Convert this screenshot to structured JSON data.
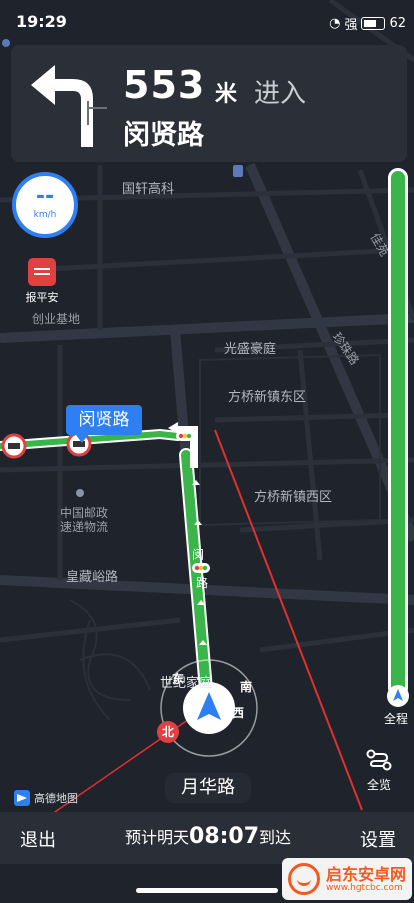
{
  "status_bar": {
    "time": "19:29",
    "signal_text": "强",
    "battery": "62"
  },
  "guidance": {
    "distance": "553",
    "unit": "米",
    "action": "进入",
    "road": "闵贤路"
  },
  "speed": {
    "value": "--",
    "unit": "km/h"
  },
  "safety": {
    "label": "报平安"
  },
  "route_progress": {
    "label": "全程"
  },
  "overview": {
    "label": "全览"
  },
  "map": {
    "labels": {
      "guoxuan": "国轩高科",
      "chuangye": "创业基地",
      "guangsheng": "光盛豪庭",
      "fangqiao_east": "方桥新镇东区",
      "fangqiao_west": "方桥新镇西区",
      "post": "中国邮政",
      "express": "速递物流",
      "huangcang": "皇藏峪路",
      "shijie": "世纪家庭",
      "zhuzhu": "珍珠路",
      "jiaxin": "佳苑",
      "minxian_bubble": "闵贤路",
      "road_vertical": "闵",
      "road_vertical2": "路"
    },
    "compass": {
      "north": "北",
      "east": "东",
      "south": "南",
      "west": "西"
    }
  },
  "current_road": "月华路",
  "map_logo": "高德地图",
  "bottom": {
    "exit": "退出",
    "eta_prefix": "预计明天",
    "eta_time": "08:07",
    "eta_suffix": "到达",
    "settings": "设置"
  },
  "watermark": {
    "title": "启东安卓网",
    "url": "www.hgtcbc.com"
  }
}
